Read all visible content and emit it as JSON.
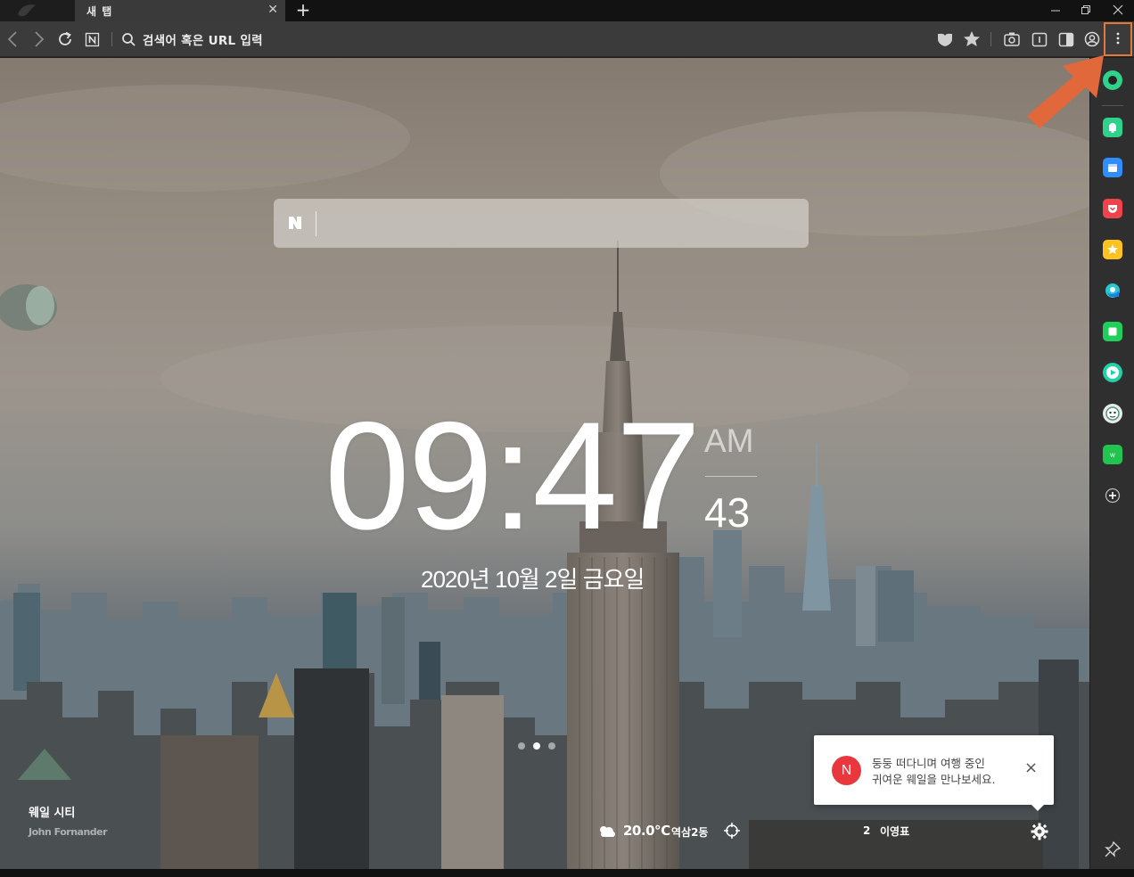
{
  "tabs": [
    {
      "title": "새 탭",
      "active": true
    }
  ],
  "toolbar": {
    "address_placeholder": "검색어 혹은 URL 입력",
    "icons": [
      "back-icon",
      "forward-icon",
      "reload-icon",
      "naver-icon",
      "search-icon",
      "shield-icon",
      "star-icon",
      "camera-icon",
      "reader-icon",
      "split-view-icon",
      "profile-icon",
      "menu-dots-icon"
    ]
  },
  "newtab": {
    "search_logo": "N",
    "clock": {
      "hours_minutes": "09:47",
      "ampm": "AM",
      "seconds": "43"
    },
    "date": "2020년 10월 2일 금요일",
    "pager": {
      "pages": 3,
      "current": 2
    },
    "credit": {
      "title": "웨일 시티",
      "author": "John Fornander"
    },
    "weather": {
      "temperature": "20.0℃",
      "location": "역삼2동"
    },
    "trending": {
      "rank": "2",
      "keyword": "이영표"
    }
  },
  "notification": {
    "badge": "N",
    "line1": "둥둥 떠다니며 여행 중인",
    "line2": "귀여운 웨일을 만나보세요.",
    "close": "×"
  },
  "sidebar": {
    "items": [
      "whale-icon",
      "alarm-icon",
      "calendar-icon",
      "pocket-icon",
      "favorites-icon",
      "translate-icon",
      "note-icon",
      "media-icon",
      "character-icon",
      "webtoon-icon",
      "add-icon"
    ]
  },
  "colors": {
    "accent_highlight": "#e07a3c",
    "notification_badge": "#e8383d",
    "sidebar_green": "#2ed28a"
  }
}
